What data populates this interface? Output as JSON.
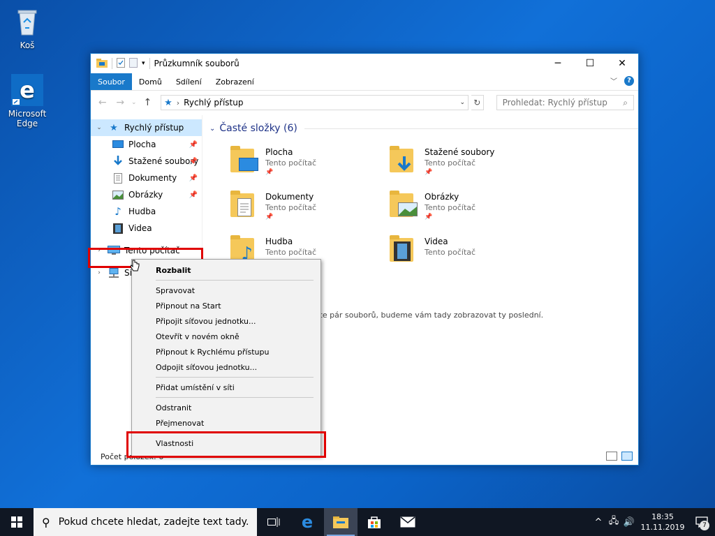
{
  "desktop": {
    "recycle_bin": "Koš",
    "edge": "Microsoft Edge"
  },
  "window": {
    "title": "Průzkumník souborů",
    "ribbon_tabs": [
      "Soubor",
      "Domů",
      "Sdílení",
      "Zobrazení"
    ],
    "address": "Rychlý přístup",
    "search_placeholder": "Prohledat: Rychlý přístup"
  },
  "navpane": {
    "quick_access": "Rychlý přístup",
    "items": [
      "Plocha",
      "Stažené soubory",
      "Dokumenty",
      "Obrázky",
      "Hudba",
      "Videa"
    ],
    "this_pc": "Tento počítač",
    "network": "Síť"
  },
  "content": {
    "group_header": "Časté složky (6)",
    "folders": [
      {
        "name": "Plocha",
        "location": "Tento počítač"
      },
      {
        "name": "Stažené soubory",
        "location": "Tento počítač"
      },
      {
        "name": "Dokumenty",
        "location": "Tento počítač"
      },
      {
        "name": "Obrázky",
        "location": "Tento počítač"
      },
      {
        "name": "Hudba",
        "location": "Tento počítač"
      },
      {
        "name": "Videa",
        "location": "Tento počítač"
      }
    ],
    "recent_hint": "vřete pár souborů, budeme vám tady zobrazovat ty poslední."
  },
  "status": {
    "item_count": "Počet položek: 6"
  },
  "context_menu": {
    "items": [
      "Rozbalit",
      "Spravovat",
      "Připnout na Start",
      "Připojit síťovou jednotku...",
      "Otevřít v novém okně",
      "Připnout k Rychlému přístupu",
      "Odpojit síťovou jednotku...",
      "Přidat umístění v síti",
      "Odstranit",
      "Přejmenovat",
      "Vlastnosti"
    ]
  },
  "taskbar": {
    "search_placeholder": "Pokud chcete hledat, zadejte text tady.",
    "time": "18:35",
    "date": "11.11.2019",
    "notifications": "7"
  },
  "colors": {
    "accent": "#1979ca",
    "highlight": "#e00000",
    "folder": "#f5c85a",
    "selection": "#cce8ff"
  }
}
